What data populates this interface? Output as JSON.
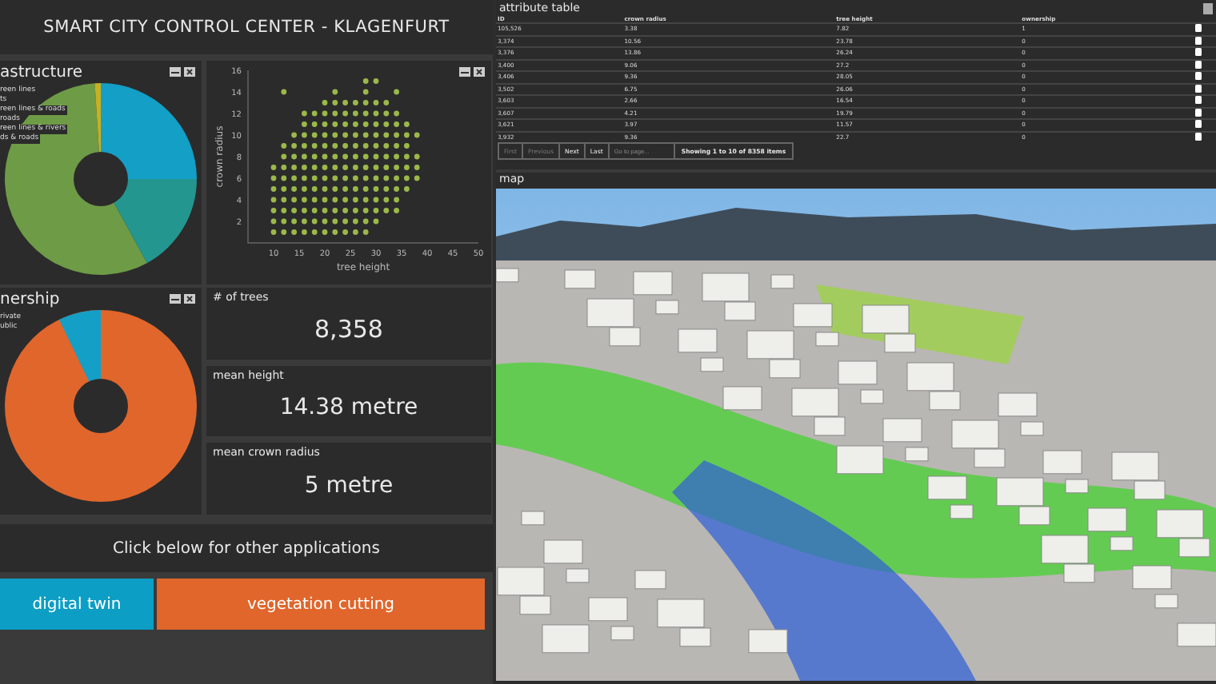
{
  "header": {
    "title": "SMART CITY CONTROL CENTER - KLAGENFURT"
  },
  "infrastructure": {
    "title": "astructure",
    "legend": [
      "reen lines",
      "ts",
      "reen lines & roads",
      "roads",
      "reen lines & rivers",
      "ds & roads"
    ]
  },
  "scatter": {
    "chart_data": {
      "type": "scatter",
      "xlabel": "tree height",
      "ylabel": "crown radius",
      "xlim": [
        5,
        50
      ],
      "ylim": [
        0,
        16
      ],
      "xticks": [
        10,
        15,
        20,
        25,
        30,
        35,
        40,
        45,
        50
      ],
      "yticks": [
        2,
        4,
        6,
        8,
        10,
        12,
        14,
        16
      ],
      "x": [
        10,
        12,
        14,
        16,
        18,
        20,
        22,
        24,
        26,
        28,
        10,
        12,
        14,
        16,
        18,
        20,
        22,
        24,
        26,
        28,
        30,
        10,
        12,
        14,
        16,
        18,
        20,
        22,
        24,
        26,
        28,
        30,
        32,
        34,
        10,
        12,
        14,
        16,
        18,
        20,
        22,
        24,
        26,
        28,
        30,
        32,
        34,
        10,
        12,
        14,
        16,
        18,
        20,
        22,
        24,
        26,
        28,
        30,
        32,
        34,
        36,
        10,
        12,
        14,
        16,
        18,
        20,
        22,
        24,
        26,
        28,
        30,
        32,
        34,
        36,
        38,
        10,
        12,
        14,
        16,
        18,
        20,
        22,
        24,
        26,
        28,
        30,
        32,
        34,
        36,
        38,
        12,
        14,
        16,
        18,
        20,
        22,
        24,
        26,
        28,
        30,
        32,
        34,
        36,
        38,
        12,
        14,
        16,
        18,
        20,
        22,
        24,
        26,
        28,
        30,
        32,
        34,
        36,
        14,
        16,
        18,
        20,
        22,
        24,
        26,
        28,
        30,
        32,
        34,
        36,
        38,
        16,
        18,
        20,
        22,
        24,
        26,
        28,
        30,
        32,
        34,
        36,
        16,
        18,
        20,
        22,
        24,
        26,
        28,
        30,
        32,
        34,
        20,
        22,
        24,
        26,
        28,
        30,
        32,
        12,
        22,
        28,
        34,
        28,
        30
      ],
      "series": [
        {
          "color": "#9bb84a",
          "values": [
            1,
            1,
            1,
            1,
            1,
            1,
            1,
            1,
            1,
            1,
            2,
            2,
            2,
            2,
            2,
            2,
            2,
            2,
            2,
            2,
            2,
            3,
            3,
            3,
            3,
            3,
            3,
            3,
            3,
            3,
            3,
            3,
            3,
            3,
            4,
            4,
            4,
            4,
            4,
            4,
            4,
            4,
            4,
            4,
            4,
            4,
            4,
            5,
            5,
            5,
            5,
            5,
            5,
            5,
            5,
            5,
            5,
            5,
            5,
            5,
            5,
            6,
            6,
            6,
            6,
            6,
            6,
            6,
            6,
            6,
            6,
            6,
            6,
            6,
            6,
            6,
            7,
            7,
            7,
            7,
            7,
            7,
            7,
            7,
            7,
            7,
            7,
            7,
            7,
            7,
            7,
            8,
            8,
            8,
            8,
            8,
            8,
            8,
            8,
            8,
            8,
            8,
            8,
            8,
            8,
            9,
            9,
            9,
            9,
            9,
            9,
            9,
            9,
            9,
            9,
            9,
            9,
            9,
            10,
            10,
            10,
            10,
            10,
            10,
            10,
            10,
            10,
            10,
            10,
            10,
            10,
            11,
            11,
            11,
            11,
            11,
            11,
            11,
            11,
            11,
            11,
            11,
            12,
            12,
            12,
            12,
            12,
            12,
            12,
            12,
            12,
            12,
            13,
            13,
            13,
            13,
            13,
            13,
            13,
            14,
            14,
            14,
            14,
            15,
            15
          ]
        }
      ]
    }
  },
  "ownership": {
    "title": "nership",
    "legend": [
      "rivate",
      "ublic"
    ]
  },
  "stats": [
    {
      "label": "# of trees",
      "value": "8,358"
    },
    {
      "label": "mean height",
      "value": "14.38 metre"
    },
    {
      "label": "mean crown radius",
      "value": "5 metre"
    }
  ],
  "apps": {
    "prompt": "Click below for other applications",
    "buttons": [
      {
        "label": "digital twin",
        "color": "#0c9ec4"
      },
      {
        "label": "vegetation cutting",
        "color": "#e0662c"
      }
    ]
  },
  "table": {
    "title": "attribute table",
    "columns": [
      "ID",
      "crown radius",
      "tree height",
      "ownership"
    ],
    "rows": [
      [
        "105,526",
        "3.38",
        "7.82",
        "1"
      ],
      [
        "3,374",
        "10.56",
        "23.78",
        "0"
      ],
      [
        "3,376",
        "13.86",
        "26.24",
        "0"
      ],
      [
        "3,400",
        "9.06",
        "27.2",
        "0"
      ],
      [
        "3,406",
        "9.36",
        "28.05",
        "0"
      ],
      [
        "3,502",
        "6.75",
        "26.06",
        "0"
      ],
      [
        "3,603",
        "2.66",
        "16.54",
        "0"
      ],
      [
        "3,607",
        "4.21",
        "19.79",
        "0"
      ],
      [
        "3,621",
        "3.97",
        "11.57",
        "0"
      ],
      [
        "3,932",
        "9.36",
        "22.7",
        "0"
      ]
    ],
    "pager": [
      {
        "label": "First",
        "disabled": true
      },
      {
        "label": "Previous",
        "disabled": true
      },
      {
        "label": "Next",
        "disabled": false
      },
      {
        "label": "Last",
        "disabled": false
      }
    ],
    "goto": {
      "placeholder": "Go to page..."
    },
    "summary": "Showing 1 to 10 of 8358 items"
  },
  "map": {
    "title": "map"
  }
}
